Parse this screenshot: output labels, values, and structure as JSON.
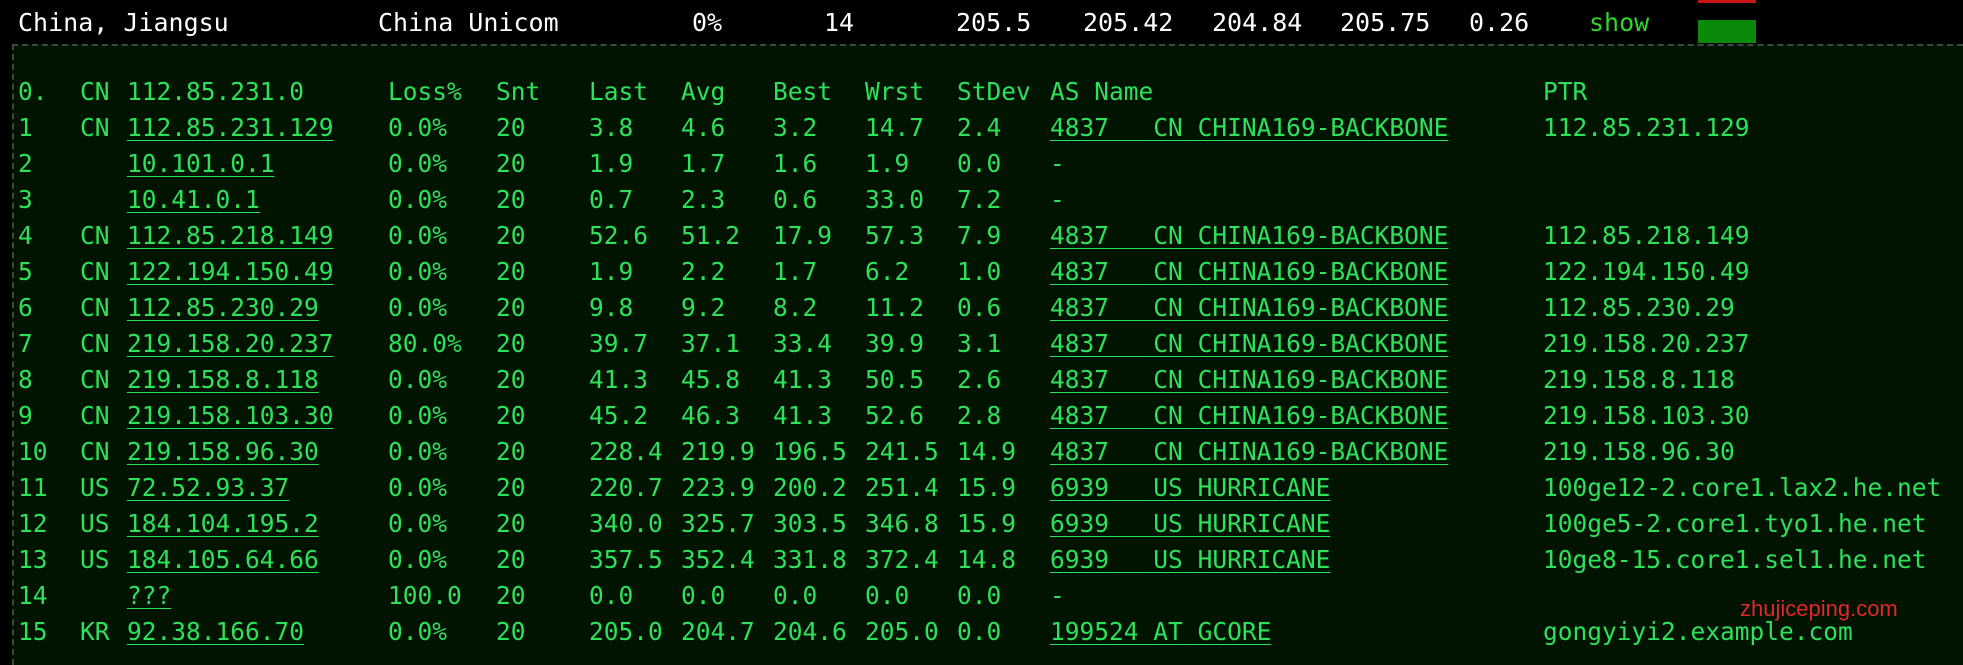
{
  "summary": {
    "location": "China, Jiangsu",
    "isp": "China Unicom",
    "loss": "0%",
    "sent": "14",
    "last": "205.5",
    "avg": "205.42",
    "best": "204.84",
    "worst": "205.75",
    "stdev": "0.26",
    "show_label": "show"
  },
  "colors": {
    "terminal_green": "#2fe05a",
    "panel_bg": "#001400",
    "flag_green": "#0a8a0a",
    "flag_red": "#c81414"
  },
  "header": {
    "hop": "0.",
    "cc": "CN",
    "ip": "112.85.231.0",
    "loss": "Loss%",
    "snt": "Snt",
    "last": "Last",
    "avg": "Avg",
    "best": "Best",
    "wrst": "Wrst",
    "stdev": "StDev",
    "as": "AS Name",
    "ptr": "PTR"
  },
  "hops": [
    {
      "hop": "1",
      "cc": "CN",
      "ip": "112.85.231.129",
      "loss": "0.0%",
      "snt": "20",
      "last": "3.8",
      "avg": "4.6",
      "best": "3.2",
      "wrst": "14.7",
      "stdev": "2.4",
      "asn": "4837",
      "as_cc": "CN",
      "as_name": "CHINA169-BACKBONE",
      "ptr": "112.85.231.129"
    },
    {
      "hop": "2",
      "cc": "",
      "ip": "10.101.0.1",
      "loss": "0.0%",
      "snt": "20",
      "last": "1.9",
      "avg": "1.7",
      "best": "1.6",
      "wrst": "1.9",
      "stdev": "0.0",
      "asn": "-",
      "as_cc": "",
      "as_name": "",
      "ptr": ""
    },
    {
      "hop": "3",
      "cc": "",
      "ip": "10.41.0.1",
      "loss": "0.0%",
      "snt": "20",
      "last": "0.7",
      "avg": "2.3",
      "best": "0.6",
      "wrst": "33.0",
      "stdev": "7.2",
      "asn": "-",
      "as_cc": "",
      "as_name": "",
      "ptr": ""
    },
    {
      "hop": "4",
      "cc": "CN",
      "ip": "112.85.218.149",
      "loss": "0.0%",
      "snt": "20",
      "last": "52.6",
      "avg": "51.2",
      "best": "17.9",
      "wrst": "57.3",
      "stdev": "7.9",
      "asn": "4837",
      "as_cc": "CN",
      "as_name": "CHINA169-BACKBONE",
      "ptr": "112.85.218.149"
    },
    {
      "hop": "5",
      "cc": "CN",
      "ip": "122.194.150.49",
      "loss": "0.0%",
      "snt": "20",
      "last": "1.9",
      "avg": "2.2",
      "best": "1.7",
      "wrst": "6.2",
      "stdev": "1.0",
      "asn": "4837",
      "as_cc": "CN",
      "as_name": "CHINA169-BACKBONE",
      "ptr": "122.194.150.49"
    },
    {
      "hop": "6",
      "cc": "CN",
      "ip": "112.85.230.29",
      "loss": "0.0%",
      "snt": "20",
      "last": "9.8",
      "avg": "9.2",
      "best": "8.2",
      "wrst": "11.2",
      "stdev": "0.6",
      "asn": "4837",
      "as_cc": "CN",
      "as_name": "CHINA169-BACKBONE",
      "ptr": "112.85.230.29"
    },
    {
      "hop": "7",
      "cc": "CN",
      "ip": "219.158.20.237",
      "loss": "80.0%",
      "snt": "20",
      "last": "39.7",
      "avg": "37.1",
      "best": "33.4",
      "wrst": "39.9",
      "stdev": "3.1",
      "asn": "4837",
      "as_cc": "CN",
      "as_name": "CHINA169-BACKBONE",
      "ptr": "219.158.20.237"
    },
    {
      "hop": "8",
      "cc": "CN",
      "ip": "219.158.8.118",
      "loss": "0.0%",
      "snt": "20",
      "last": "41.3",
      "avg": "45.8",
      "best": "41.3",
      "wrst": "50.5",
      "stdev": "2.6",
      "asn": "4837",
      "as_cc": "CN",
      "as_name": "CHINA169-BACKBONE",
      "ptr": "219.158.8.118"
    },
    {
      "hop": "9",
      "cc": "CN",
      "ip": "219.158.103.30",
      "loss": "0.0%",
      "snt": "20",
      "last": "45.2",
      "avg": "46.3",
      "best": "41.3",
      "wrst": "52.6",
      "stdev": "2.8",
      "asn": "4837",
      "as_cc": "CN",
      "as_name": "CHINA169-BACKBONE",
      "ptr": "219.158.103.30"
    },
    {
      "hop": "10",
      "cc": "CN",
      "ip": "219.158.96.30",
      "loss": "0.0%",
      "snt": "20",
      "last": "228.4",
      "avg": "219.9",
      "best": "196.5",
      "wrst": "241.5",
      "stdev": "14.9",
      "asn": "4837",
      "as_cc": "CN",
      "as_name": "CHINA169-BACKBONE",
      "ptr": "219.158.96.30"
    },
    {
      "hop": "11",
      "cc": "US",
      "ip": "72.52.93.37",
      "loss": "0.0%",
      "snt": "20",
      "last": "220.7",
      "avg": "223.9",
      "best": "200.2",
      "wrst": "251.4",
      "stdev": "15.9",
      "asn": "6939",
      "as_cc": "US",
      "as_name": "HURRICANE",
      "ptr": "100ge12-2.core1.lax2.he.net"
    },
    {
      "hop": "12",
      "cc": "US",
      "ip": "184.104.195.2",
      "loss": "0.0%",
      "snt": "20",
      "last": "340.0",
      "avg": "325.7",
      "best": "303.5",
      "wrst": "346.8",
      "stdev": "15.9",
      "asn": "6939",
      "as_cc": "US",
      "as_name": "HURRICANE",
      "ptr": "100ge5-2.core1.tyo1.he.net"
    },
    {
      "hop": "13",
      "cc": "US",
      "ip": "184.105.64.66",
      "loss": "0.0%",
      "snt": "20",
      "last": "357.5",
      "avg": "352.4",
      "best": "331.8",
      "wrst": "372.4",
      "stdev": "14.8",
      "asn": "6939",
      "as_cc": "US",
      "as_name": "HURRICANE",
      "ptr": "10ge8-15.core1.sel1.he.net"
    },
    {
      "hop": "14",
      "cc": "",
      "ip": "???",
      "loss": "100.0",
      "snt": "20",
      "last": "0.0",
      "avg": "0.0",
      "best": "0.0",
      "wrst": "0.0",
      "stdev": "0.0",
      "asn": "-",
      "as_cc": "",
      "as_name": "",
      "ptr": ""
    },
    {
      "hop": "15",
      "cc": "KR",
      "ip": "92.38.166.70",
      "loss": "0.0%",
      "snt": "20",
      "last": "205.0",
      "avg": "204.7",
      "best": "204.6",
      "wrst": "205.0",
      "stdev": "0.0",
      "asn": "199524",
      "as_cc": "AT",
      "as_name": "GCORE",
      "ptr": "gongyiyi2.example.com"
    }
  ],
  "watermark": "zhujiceping.com"
}
